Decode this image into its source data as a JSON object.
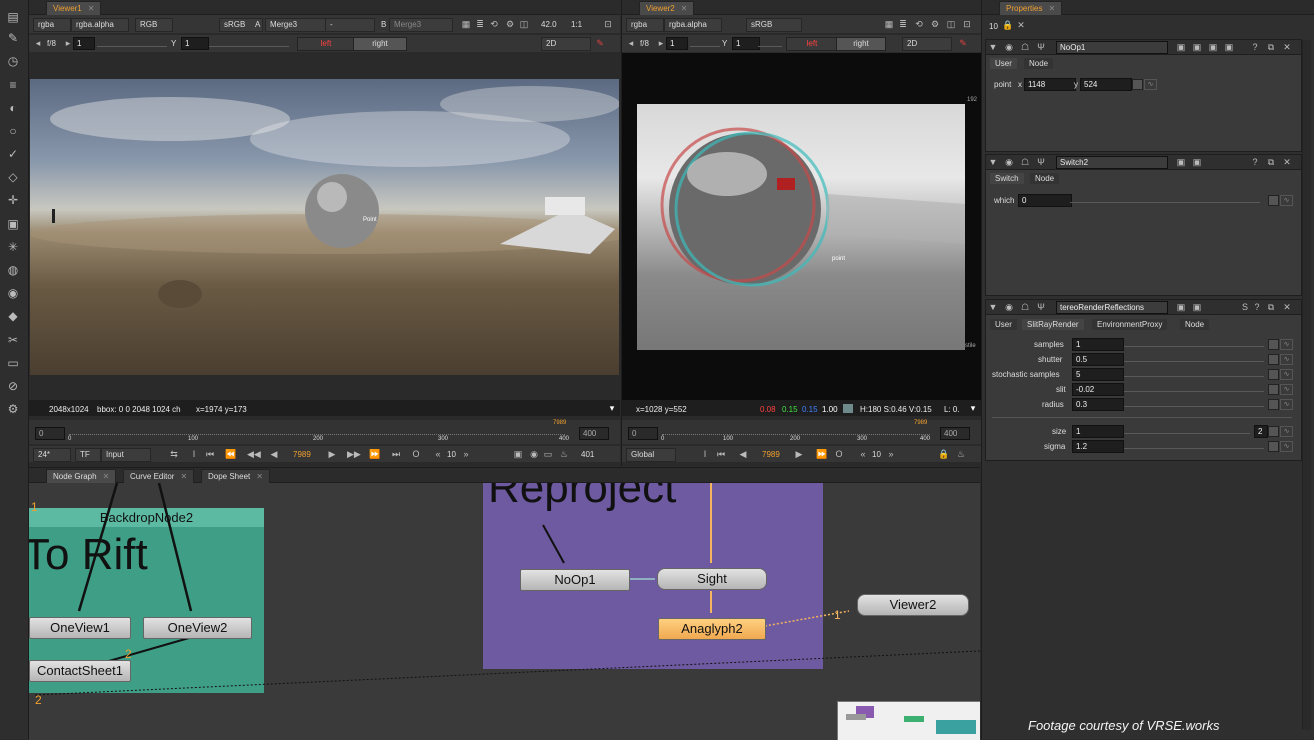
{
  "viewer1": {
    "tab": "Viewer1",
    "channels": "rgba",
    "alpha": "rgba.alpha",
    "space": "RGB",
    "lut": "sRGB",
    "a_input": "Merge3",
    "dash": "-",
    "b_input": "Merge3",
    "a_label": "A",
    "b_label": "B",
    "gain": "42.0",
    "ratio": "1:1",
    "fstop": "f/8",
    "frame_field": "1",
    "y_label": "Y",
    "y_field": "1",
    "left": "left",
    "right": "right",
    "mode": "2D",
    "status_size": "2048x1024",
    "status_bbox": "bbox: 0 0 2048 1024 ch",
    "status_xy": "x=1974 y=173",
    "tick_labels": [
      "0",
      "100",
      "200",
      "300",
      "400"
    ],
    "range_start": "0",
    "range_end": "400",
    "marker": "7989",
    "fps": "24*",
    "tf": "TF",
    "input": "Input",
    "frame": "7989",
    "step": "10",
    "end_frame": "401"
  },
  "viewer2": {
    "tab": "Viewer2",
    "channels": "rgba",
    "alpha": "rgba.alpha",
    "lut": "sRGB",
    "fstop": "f/8",
    "frame_field": "1",
    "y_label": "Y",
    "y_field": "1",
    "left": "left",
    "right": "right",
    "mode": "2D",
    "edge_top": "192",
    "edge_bottom": "stile",
    "status_xy": "x=1028 y=552",
    "r": "0.08",
    "g": "0.15",
    "b": "0.15",
    "a": "1.00",
    "hsv": "H:180 S:0.46 V:0.15",
    "lum": "L: 0.",
    "tick_labels": [
      "0",
      "100",
      "200",
      "300",
      "400"
    ],
    "range_start": "0",
    "range_end": "400",
    "marker": "7989",
    "global": "Global",
    "frame": "7989",
    "step": "10"
  },
  "image_labels": {
    "point1": "Point",
    "point2": "point"
  },
  "graph": {
    "tabs": [
      "Node Graph",
      "Curve Editor",
      "Dope Sheet"
    ],
    "backdrop_title": "BackdropNode2",
    "backdrop_text": "To Rift",
    "reproject_text": "Reproject",
    "nodes": {
      "oneview1": "OneView1",
      "oneview2": "OneView2",
      "contactsheet": "ContactSheet1",
      "noop": "NoOp1",
      "sight": "Sight",
      "anaglyph": "Anaglyph2",
      "viewer": "Viewer2"
    },
    "num_1a": "1",
    "num_2a": "2",
    "num_2b": "2",
    "num_1b": "1",
    "credit": "Footage courtesy of VRSE.works"
  },
  "properties": {
    "tab": "Properties",
    "count": "10",
    "noop": {
      "name": "NoOp1",
      "tabs": [
        "User",
        "Node"
      ],
      "point_label": "point",
      "x_label": "x",
      "x": "1148",
      "y_label": "y",
      "y": "524"
    },
    "switch": {
      "name": "Switch2",
      "tabs": [
        "Switch",
        "Node"
      ],
      "which_label": "which",
      "which": "0"
    },
    "srr": {
      "name": "tereoRenderReflections",
      "tabs": [
        "User",
        "SlitRayRender",
        "EnvironmentProxy",
        "Node"
      ],
      "params": [
        {
          "label": "samples",
          "value": "1"
        },
        {
          "label": "shutter",
          "value": "0.5"
        },
        {
          "label": "stochastic samples",
          "value": "5"
        },
        {
          "label": "slit",
          "value": "-0.02"
        },
        {
          "label": "radius",
          "value": "0.3"
        },
        {
          "label": "size",
          "value": "1"
        },
        {
          "label": "sigma",
          "value": "1.2"
        }
      ],
      "size_extra": "2"
    }
  },
  "colors": {
    "accent": "#f0a030",
    "backdrop": "#3f9e86",
    "reproject": "#6e5aa0",
    "anaglyph": "#f5b560"
  }
}
